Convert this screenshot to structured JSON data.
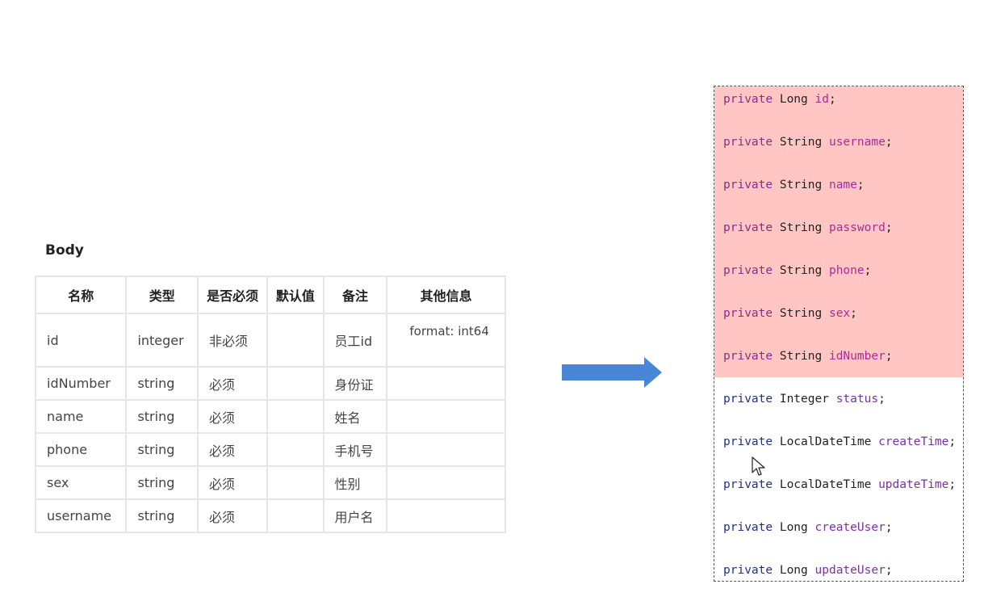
{
  "body_title": "Body",
  "table": {
    "headers": [
      "名称",
      "类型",
      "是否必须",
      "默认值",
      "备注",
      "其他信息"
    ],
    "rows": [
      [
        "id",
        "integer",
        "非必须",
        "",
        "员工id",
        "format: int64"
      ],
      [
        "idNumber",
        "string",
        "必须",
        "",
        "身份证",
        ""
      ],
      [
        "name",
        "string",
        "必须",
        "",
        "姓名",
        ""
      ],
      [
        "phone",
        "string",
        "必须",
        "",
        "手机号",
        ""
      ],
      [
        "sex",
        "string",
        "必须",
        "",
        "性别",
        ""
      ],
      [
        "username",
        "string",
        "必须",
        "",
        "用户名",
        ""
      ]
    ]
  },
  "code": {
    "lines": [
      {
        "kw": "private",
        "type": "Long",
        "field": "id",
        "highlighted": true
      },
      {
        "kw": "private",
        "type": "String",
        "field": "username",
        "highlighted": true
      },
      {
        "kw": "private",
        "type": "String",
        "field": "name",
        "highlighted": true
      },
      {
        "kw": "private",
        "type": "String",
        "field": "password",
        "highlighted": true
      },
      {
        "kw": "private",
        "type": "String",
        "field": "phone",
        "highlighted": true
      },
      {
        "kw": "private",
        "type": "String",
        "field": "sex",
        "highlighted": true
      },
      {
        "kw": "private",
        "type": "String",
        "field": "idNumber",
        "highlighted": true
      },
      {
        "kw": "private",
        "type": "Integer",
        "field": "status",
        "highlighted": false
      },
      {
        "kw": "private",
        "type": "LocalDateTime",
        "field": "createTime",
        "highlighted": false
      },
      {
        "kw": "private",
        "type": "LocalDateTime",
        "field": "updateTime",
        "highlighted": false
      },
      {
        "kw": "private",
        "type": "Long",
        "field": "createUser",
        "highlighted": false
      },
      {
        "kw": "private",
        "type": "Long",
        "field": "updateUser",
        "highlighted": false
      }
    ],
    "semicolon": ";",
    "highlight_color": "#ffc6c4"
  },
  "colors": {
    "arrow": "#4a86d8",
    "keyword": "#8a2b8a",
    "field": "#b0279b"
  },
  "icons": {
    "arrow": "right-arrow-icon",
    "cursor": "mouse-pointer-icon"
  }
}
